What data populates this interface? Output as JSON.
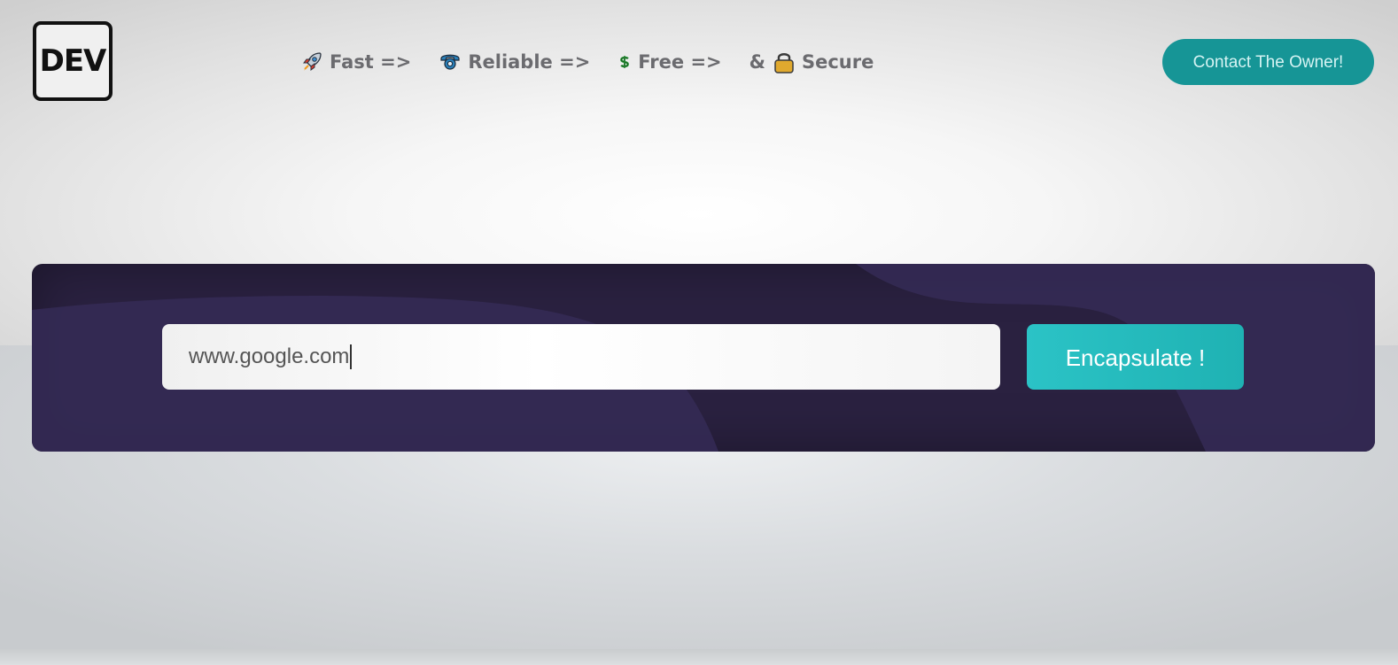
{
  "header": {
    "logo_text": "DEV",
    "features": [
      {
        "icon": "rocket-icon",
        "label": "Fast =>"
      },
      {
        "icon": "telephone-icon",
        "label": "Reliable =>"
      },
      {
        "icon": "dollar-icon",
        "label": "Free =>"
      },
      {
        "prefix": "&",
        "icon": "lock-icon",
        "label": "Secure"
      }
    ],
    "contact_label": "Contact The Owner!"
  },
  "main": {
    "url_value": "www.google.com",
    "submit_label": "Encapsulate !"
  },
  "colors": {
    "accent": "#169596",
    "button": "#25bcbf",
    "panel": "#2a2140",
    "panel_wave": "#362c56",
    "feature_text": "#6b6b6f"
  }
}
